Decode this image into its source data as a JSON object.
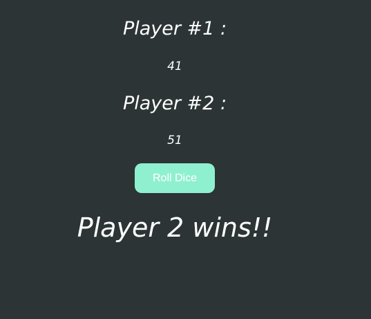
{
  "player1": {
    "title": "Player #1 :",
    "score": "41"
  },
  "player2": {
    "title": "Player #2 :",
    "score": "51"
  },
  "roll_button": {
    "label": "Roll Dice",
    "color": "#8ff0cf"
  },
  "result": {
    "message": "Player 2 wins!!"
  },
  "theme": {
    "background": "#2c3435",
    "text": "#ffffff"
  }
}
